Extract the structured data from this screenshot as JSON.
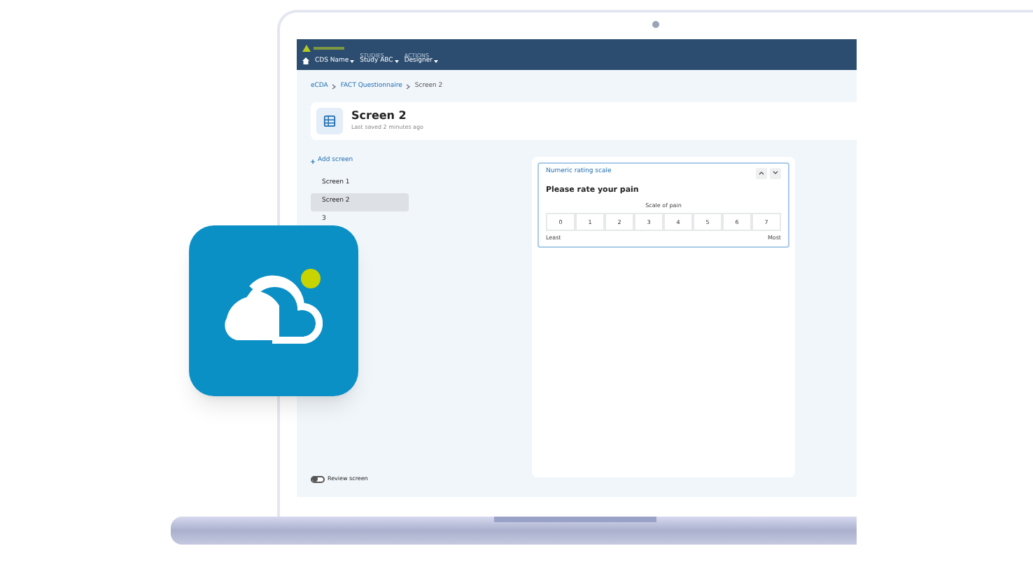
{
  "nav": {
    "items": [
      {
        "value": "CDS Name"
      },
      {
        "label": "STUDIES",
        "value": "Study ABC"
      },
      {
        "label": "ACTIONS",
        "value": "Designer"
      }
    ]
  },
  "breadcrumb": [
    "eCDA",
    "FACT Questionnaire",
    "Screen 2"
  ],
  "header": {
    "title": "Screen 2",
    "subtitle": "Last saved 2 minutes ago"
  },
  "sidebar": {
    "add": "Add screen",
    "items": [
      {
        "label": "Screen 1",
        "selected": false
      },
      {
        "label": "Screen 2",
        "selected": true
      },
      {
        "label": "3",
        "selected": false
      }
    ],
    "review": {
      "label": "Review screen",
      "on": false
    }
  },
  "question": {
    "type": "Numeric rating scale",
    "prompt": "Please rate your pain",
    "scale_title": "Scale of pain",
    "options": [
      "0",
      "1",
      "2",
      "3",
      "4",
      "5",
      "6",
      "7"
    ],
    "min_label": "Least",
    "max_label": "Most"
  }
}
